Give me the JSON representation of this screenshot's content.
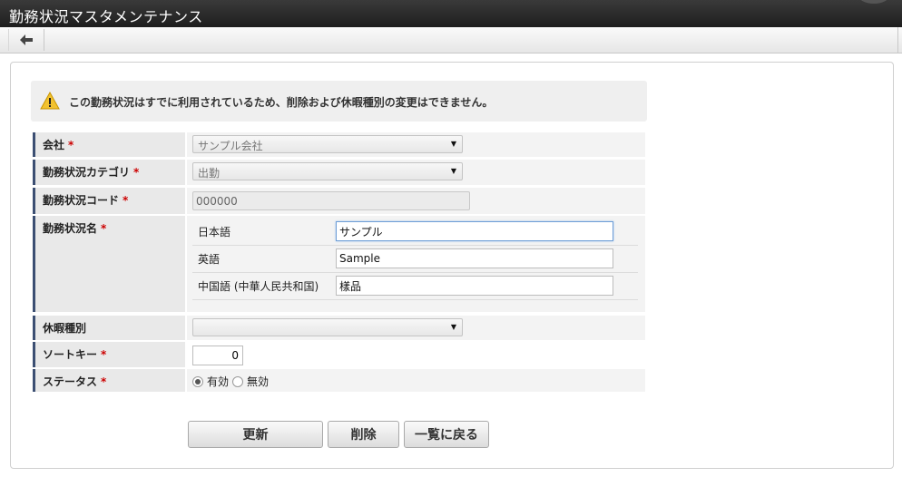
{
  "window": {
    "title": "勤務状況マスタメンテナンス"
  },
  "toolbar": {
    "back_icon": "arrow-left-icon"
  },
  "alert": {
    "icon": "warning-icon",
    "message": "この勤務状況はすでに利用されているため、削除および休暇種別の変更はできません。"
  },
  "form": {
    "required_mark": "*",
    "company": {
      "label": "会社",
      "value": "サンプル会社"
    },
    "category": {
      "label": "勤務状況カテゴリ",
      "value": "出勤"
    },
    "code": {
      "label": "勤務状況コード",
      "value": "000000"
    },
    "name": {
      "label": "勤務状況名",
      "languages": [
        {
          "label": "日本語",
          "value": "サンプル"
        },
        {
          "label": "英語",
          "value": "Sample"
        },
        {
          "label": "中国語 (中華人民共和国)",
          "value": "樣品"
        }
      ]
    },
    "leave_type": {
      "label": "休暇種別",
      "value": ""
    },
    "sort_key": {
      "label": "ソートキー",
      "value": "0"
    },
    "status": {
      "label": "ステータス",
      "options": [
        {
          "label": "有効",
          "selected": true
        },
        {
          "label": "無効",
          "selected": false
        }
      ]
    }
  },
  "buttons": {
    "update": "更新",
    "delete": "削除",
    "back_to_list": "一覧に戻る"
  }
}
